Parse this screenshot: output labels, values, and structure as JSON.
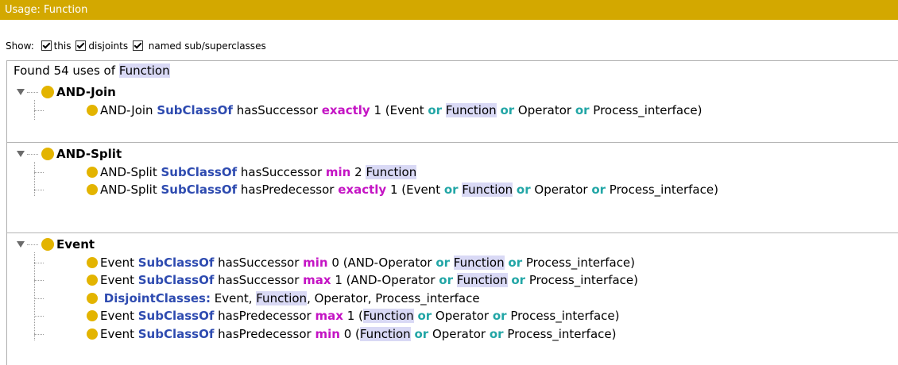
{
  "title": "Usage: Function",
  "show_bar": {
    "label": "Show:",
    "options": [
      {
        "label": "this",
        "checked": true
      },
      {
        "label": "disjoints",
        "checked": true
      },
      {
        "label": "named sub/superclasses",
        "checked": true
      }
    ]
  },
  "found": {
    "prefix": "Found 54 uses of",
    "entity": "Function"
  },
  "groups": [
    {
      "name": "AND-Join",
      "items": [
        {
          "tokens": [
            {
              "t": "AND-Join ",
              "c": ""
            },
            {
              "t": "SubClassOf",
              "c": "kw-blue"
            },
            {
              "t": " hasSuccessor ",
              "c": ""
            },
            {
              "t": "exactly",
              "c": "kw-mag"
            },
            {
              "t": " 1 (Event ",
              "c": ""
            },
            {
              "t": "or",
              "c": "kw-teal"
            },
            {
              "t": " ",
              "c": ""
            },
            {
              "t": "Function",
              "c": "hl"
            },
            {
              "t": " ",
              "c": ""
            },
            {
              "t": "or",
              "c": "kw-teal"
            },
            {
              "t": " Operator ",
              "c": ""
            },
            {
              "t": "or",
              "c": "kw-teal"
            },
            {
              "t": " Process_interface)",
              "c": ""
            }
          ]
        }
      ]
    },
    {
      "name": "AND-Split",
      "items": [
        {
          "tokens": [
            {
              "t": "AND-Split ",
              "c": ""
            },
            {
              "t": "SubClassOf",
              "c": "kw-blue"
            },
            {
              "t": " hasSuccessor ",
              "c": ""
            },
            {
              "t": "min",
              "c": "kw-mag"
            },
            {
              "t": " 2 ",
              "c": ""
            },
            {
              "t": "Function",
              "c": "hl"
            }
          ]
        },
        {
          "tokens": [
            {
              "t": "AND-Split ",
              "c": ""
            },
            {
              "t": "SubClassOf",
              "c": "kw-blue"
            },
            {
              "t": " hasPredecessor ",
              "c": ""
            },
            {
              "t": "exactly",
              "c": "kw-mag"
            },
            {
              "t": " 1 (Event ",
              "c": ""
            },
            {
              "t": "or",
              "c": "kw-teal"
            },
            {
              "t": " ",
              "c": ""
            },
            {
              "t": "Function",
              "c": "hl"
            },
            {
              "t": " ",
              "c": ""
            },
            {
              "t": "or",
              "c": "kw-teal"
            },
            {
              "t": " Operator ",
              "c": ""
            },
            {
              "t": "or",
              "c": "kw-teal"
            },
            {
              "t": " Process_interface)",
              "c": ""
            }
          ]
        }
      ]
    },
    {
      "name": "Event",
      "items": [
        {
          "tokens": [
            {
              "t": "Event ",
              "c": ""
            },
            {
              "t": "SubClassOf",
              "c": "kw-blue"
            },
            {
              "t": " hasSuccessor ",
              "c": ""
            },
            {
              "t": "min",
              "c": "kw-mag"
            },
            {
              "t": " 0 (AND-Operator ",
              "c": ""
            },
            {
              "t": "or",
              "c": "kw-teal"
            },
            {
              "t": " ",
              "c": ""
            },
            {
              "t": "Function",
              "c": "hl"
            },
            {
              "t": " ",
              "c": ""
            },
            {
              "t": "or",
              "c": "kw-teal"
            },
            {
              "t": " Process_interface)",
              "c": ""
            }
          ]
        },
        {
          "tokens": [
            {
              "t": "Event ",
              "c": ""
            },
            {
              "t": "SubClassOf",
              "c": "kw-blue"
            },
            {
              "t": " hasSuccessor ",
              "c": ""
            },
            {
              "t": "max",
              "c": "kw-mag"
            },
            {
              "t": " 1 (AND-Operator ",
              "c": ""
            },
            {
              "t": "or",
              "c": "kw-teal"
            },
            {
              "t": " ",
              "c": ""
            },
            {
              "t": "Function",
              "c": "hl"
            },
            {
              "t": " ",
              "c": ""
            },
            {
              "t": "or",
              "c": "kw-teal"
            },
            {
              "t": " Process_interface)",
              "c": ""
            }
          ]
        },
        {
          "tokens": [
            {
              "t": " ",
              "c": ""
            },
            {
              "t": "DisjointClasses:",
              "c": "kw-blue"
            },
            {
              "t": " Event, ",
              "c": ""
            },
            {
              "t": "Function",
              "c": "hl"
            },
            {
              "t": ", Operator, Process_interface",
              "c": ""
            }
          ]
        },
        {
          "tokens": [
            {
              "t": "Event ",
              "c": ""
            },
            {
              "t": "SubClassOf",
              "c": "kw-blue"
            },
            {
              "t": " hasPredecessor ",
              "c": ""
            },
            {
              "t": "max",
              "c": "kw-mag"
            },
            {
              "t": " 1 (",
              "c": ""
            },
            {
              "t": "Function",
              "c": "hl"
            },
            {
              "t": " ",
              "c": ""
            },
            {
              "t": "or",
              "c": "kw-teal"
            },
            {
              "t": " Operator ",
              "c": ""
            },
            {
              "t": "or",
              "c": "kw-teal"
            },
            {
              "t": " Process_interface)",
              "c": ""
            }
          ]
        },
        {
          "tokens": [
            {
              "t": "Event ",
              "c": ""
            },
            {
              "t": "SubClassOf",
              "c": "kw-blue"
            },
            {
              "t": " hasPredecessor ",
              "c": ""
            },
            {
              "t": "min",
              "c": "kw-mag"
            },
            {
              "t": " 0 (",
              "c": ""
            },
            {
              "t": "Function",
              "c": "hl"
            },
            {
              "t": " ",
              "c": ""
            },
            {
              "t": "or",
              "c": "kw-teal"
            },
            {
              "t": " Operator ",
              "c": ""
            },
            {
              "t": "or",
              "c": "kw-teal"
            },
            {
              "t": " Process_interface)",
              "c": ""
            }
          ]
        }
      ]
    }
  ]
}
